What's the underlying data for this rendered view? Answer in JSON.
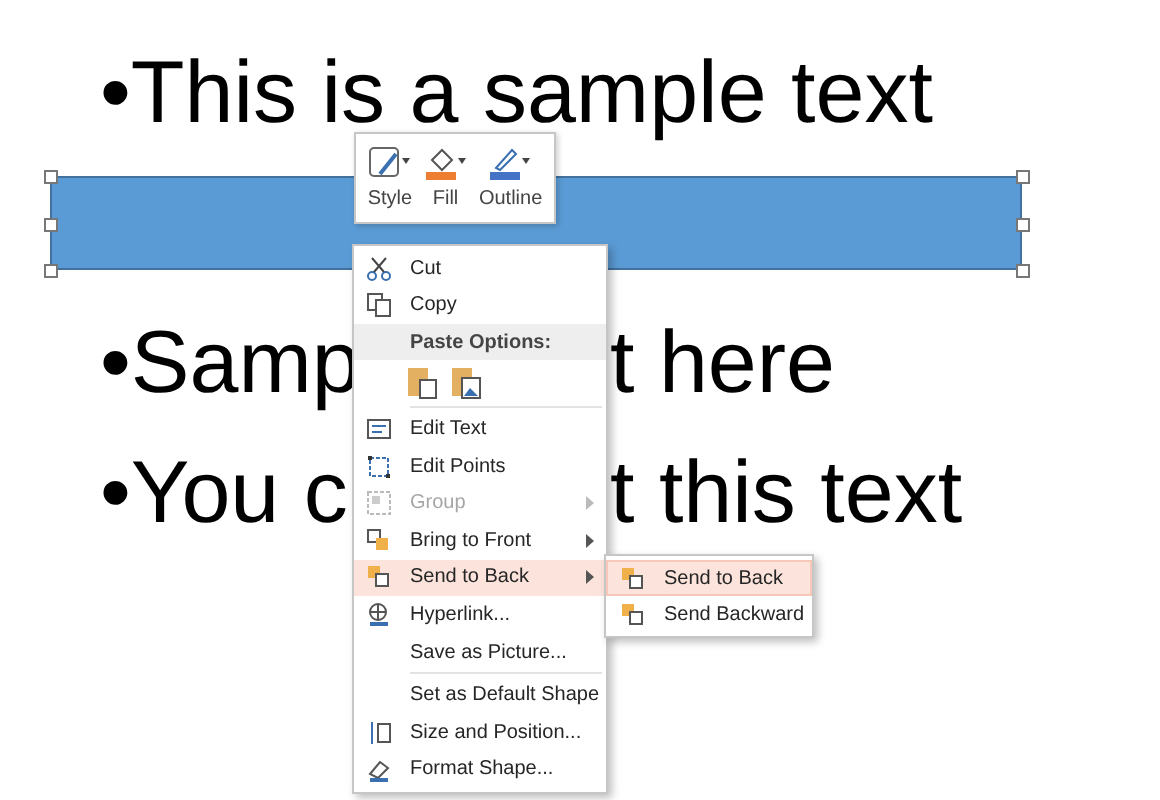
{
  "slide": {
    "bullets": [
      {
        "parts": [
          "•This is a sample text"
        ]
      },
      {
        "parts": [
          "•Samp",
          "t here"
        ]
      },
      {
        "parts": [
          "•You c",
          "t this text"
        ]
      }
    ],
    "shape": {
      "selected": true
    }
  },
  "mini_toolbar": {
    "buttons": [
      {
        "label": "Style"
      },
      {
        "label": "Fill"
      },
      {
        "label": "Outline"
      }
    ]
  },
  "context_menu": {
    "items": [
      {
        "kind": "command",
        "label": "Cut",
        "disabled": false,
        "submenu": false,
        "selected": false
      },
      {
        "kind": "command",
        "label": "Copy",
        "disabled": false,
        "submenu": false,
        "selected": false
      },
      {
        "kind": "header",
        "label": "Paste Options:"
      },
      {
        "kind": "paste_icons"
      },
      {
        "kind": "separator"
      },
      {
        "kind": "command",
        "label": "Edit Text",
        "disabled": false,
        "submenu": false,
        "selected": false
      },
      {
        "kind": "command",
        "label": "Edit Points",
        "disabled": false,
        "submenu": false,
        "selected": false
      },
      {
        "kind": "command",
        "label": "Group",
        "disabled": true,
        "submenu": true,
        "selected": false
      },
      {
        "kind": "command",
        "label": "Bring to Front",
        "disabled": false,
        "submenu": true,
        "selected": false
      },
      {
        "kind": "command",
        "label": "Send to Back",
        "disabled": false,
        "submenu": true,
        "selected": true
      },
      {
        "kind": "command",
        "label": "Hyperlink...",
        "disabled": false,
        "submenu": false,
        "selected": false
      },
      {
        "kind": "command",
        "label": "Save as Picture...",
        "disabled": false,
        "submenu": false,
        "selected": false
      },
      {
        "kind": "separator"
      },
      {
        "kind": "command",
        "label": "Set as Default Shape",
        "disabled": false,
        "submenu": false,
        "selected": false
      },
      {
        "kind": "command",
        "label": "Size and Position...",
        "disabled": false,
        "submenu": false,
        "selected": false
      },
      {
        "kind": "command",
        "label": "Format Shape...",
        "disabled": false,
        "submenu": false,
        "selected": false
      }
    ]
  },
  "submenu": {
    "items": [
      {
        "label": "Send to Back",
        "selected": true
      },
      {
        "label": "Send Backward",
        "selected": false
      }
    ]
  }
}
